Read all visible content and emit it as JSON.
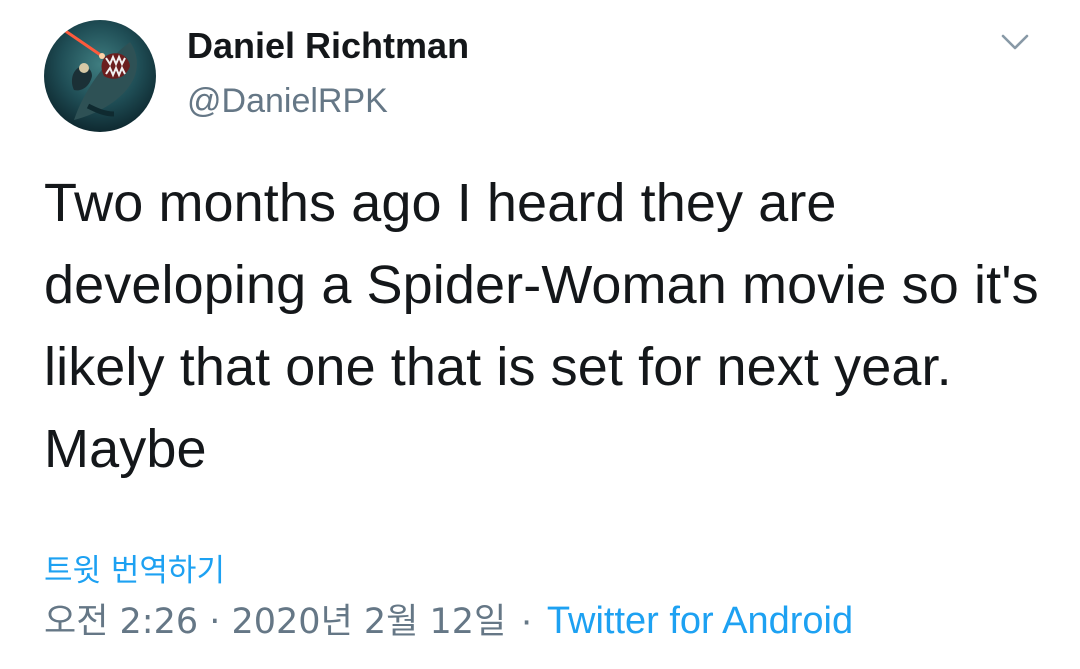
{
  "colors": {
    "accent": "#1da1f2",
    "secondary_text": "#657786",
    "primary_text": "#14171a"
  },
  "author": {
    "display_name": "Daniel Richtman",
    "handle": "@DanielRPK",
    "avatar_icon": "shark-avatar-image"
  },
  "menu": {
    "icon": "chevron-down-icon"
  },
  "tweet": {
    "text": "Two months ago I heard they are developing a Spider-Woman movie so it's likely that one that is set for next year. Maybe",
    "translate_label": "트윗 번역하기",
    "timestamp": "오전 2:26 · 2020년 2월 12일",
    "separator": "·",
    "source": "Twitter for Android"
  }
}
